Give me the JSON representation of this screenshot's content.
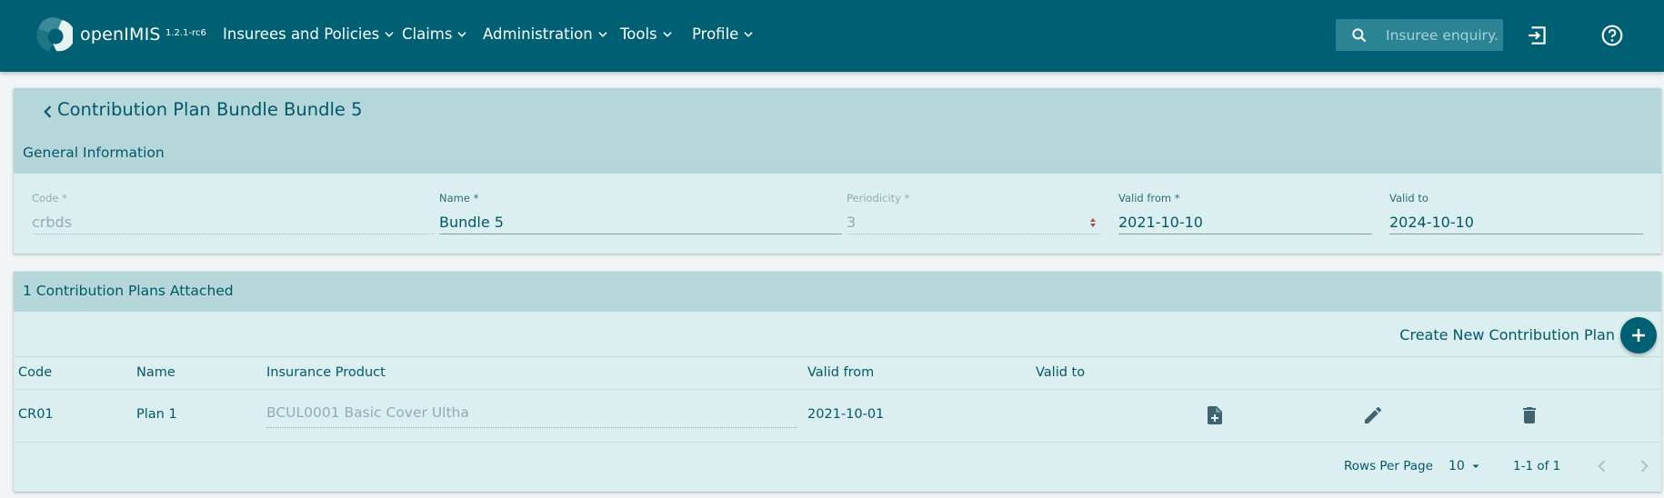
{
  "app": {
    "brand": "openIMIS",
    "version": "1.2.1-rc6",
    "menu": [
      {
        "label": "Insurees and Policies"
      },
      {
        "label": "Claims"
      },
      {
        "label": "Administration"
      },
      {
        "label": "Tools"
      },
      {
        "label": "Profile"
      }
    ],
    "search": {
      "placeholder": "Insuree enquiry..",
      "value": ""
    },
    "icons": [
      "search-icon",
      "logout-icon",
      "help-icon",
      "chevron-down-icon",
      "back-icon",
      "new-document-icon",
      "edit-icon",
      "delete-icon",
      "add-icon"
    ]
  },
  "page": {
    "title": "Contribution Plan Bundle Bundle 5",
    "general_section": "General Information",
    "fields": {
      "code": {
        "label": "Code *",
        "value": "crbds"
      },
      "name": {
        "label": "Name *",
        "value": "Bundle 5"
      },
      "periodicity": {
        "label": "Periodicity *",
        "value": "3"
      },
      "valid_from": {
        "label": "Valid from *",
        "value": "2021-10-10"
      },
      "valid_to": {
        "label": "Valid to",
        "value": "2024-10-10"
      }
    }
  },
  "plans": {
    "section_title": "1 Contribution Plans Attached",
    "create_label": "Create New Contribution Plan",
    "columns": [
      "Code",
      "Name",
      "Insurance Product",
      "Valid from",
      "Valid to"
    ],
    "rows": [
      {
        "code": "CR01",
        "name": "Plan 1",
        "product": "BCUL0001 Basic Cover Ultha",
        "valid_from": "2021-10-01",
        "valid_to": ""
      }
    ],
    "pagination": {
      "rows_per_page_label": "Rows Per Page",
      "rows_per_page": "10",
      "range": "1-1 of 1"
    }
  },
  "colors": {
    "appbar": "#006073",
    "card_header": "#b5d7d9",
    "card_body": "#dceff0",
    "text": "#00586a"
  }
}
